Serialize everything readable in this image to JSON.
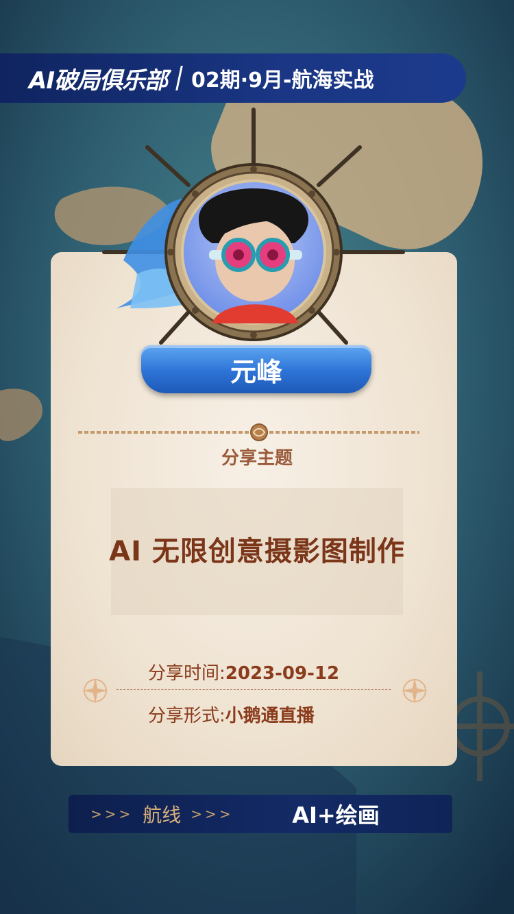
{
  "header": {
    "brand": "AI破局俱乐部",
    "issue": "02期·9月-航海实战"
  },
  "speaker": {
    "name": "元峰"
  },
  "topic": {
    "label": "分享主题",
    "title": "AI 无限创意摄影图制作"
  },
  "details": {
    "time_label": "分享时间:",
    "time_value": "2023-09-12",
    "format_label": "分享形式:",
    "format_value": "小鹅通直播"
  },
  "footer": {
    "arrows_left": ">>>",
    "route_label": "航线",
    "arrows_right": ">>>",
    "route_value": "AI+绘画"
  },
  "colors": {
    "accent_blue": "#2d73d6",
    "header_navy": "#1a3684",
    "text_brown": "#8a3c1c",
    "card_paper": "#f3e8d8"
  }
}
